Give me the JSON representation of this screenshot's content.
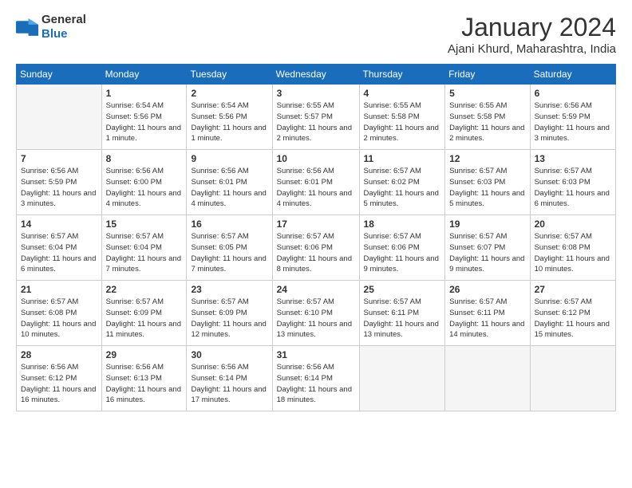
{
  "header": {
    "logo_general": "General",
    "logo_blue": "Blue",
    "month_title": "January 2024",
    "location": "Ajani Khurd, Maharashtra, India"
  },
  "weekdays": [
    "Sunday",
    "Monday",
    "Tuesday",
    "Wednesday",
    "Thursday",
    "Friday",
    "Saturday"
  ],
  "weeks": [
    [
      {
        "day": "",
        "empty": true
      },
      {
        "day": "1",
        "sunrise": "6:54 AM",
        "sunset": "5:56 PM",
        "daylight": "11 hours and 1 minute."
      },
      {
        "day": "2",
        "sunrise": "6:54 AM",
        "sunset": "5:56 PM",
        "daylight": "11 hours and 1 minute."
      },
      {
        "day": "3",
        "sunrise": "6:55 AM",
        "sunset": "5:57 PM",
        "daylight": "11 hours and 2 minutes."
      },
      {
        "day": "4",
        "sunrise": "6:55 AM",
        "sunset": "5:58 PM",
        "daylight": "11 hours and 2 minutes."
      },
      {
        "day": "5",
        "sunrise": "6:55 AM",
        "sunset": "5:58 PM",
        "daylight": "11 hours and 2 minutes."
      },
      {
        "day": "6",
        "sunrise": "6:56 AM",
        "sunset": "5:59 PM",
        "daylight": "11 hours and 3 minutes."
      }
    ],
    [
      {
        "day": "7",
        "sunrise": "6:56 AM",
        "sunset": "5:59 PM",
        "daylight": "11 hours and 3 minutes."
      },
      {
        "day": "8",
        "sunrise": "6:56 AM",
        "sunset": "6:00 PM",
        "daylight": "11 hours and 4 minutes."
      },
      {
        "day": "9",
        "sunrise": "6:56 AM",
        "sunset": "6:01 PM",
        "daylight": "11 hours and 4 minutes."
      },
      {
        "day": "10",
        "sunrise": "6:56 AM",
        "sunset": "6:01 PM",
        "daylight": "11 hours and 4 minutes."
      },
      {
        "day": "11",
        "sunrise": "6:57 AM",
        "sunset": "6:02 PM",
        "daylight": "11 hours and 5 minutes."
      },
      {
        "day": "12",
        "sunrise": "6:57 AM",
        "sunset": "6:03 PM",
        "daylight": "11 hours and 5 minutes."
      },
      {
        "day": "13",
        "sunrise": "6:57 AM",
        "sunset": "6:03 PM",
        "daylight": "11 hours and 6 minutes."
      }
    ],
    [
      {
        "day": "14",
        "sunrise": "6:57 AM",
        "sunset": "6:04 PM",
        "daylight": "11 hours and 6 minutes."
      },
      {
        "day": "15",
        "sunrise": "6:57 AM",
        "sunset": "6:04 PM",
        "daylight": "11 hours and 7 minutes."
      },
      {
        "day": "16",
        "sunrise": "6:57 AM",
        "sunset": "6:05 PM",
        "daylight": "11 hours and 7 minutes."
      },
      {
        "day": "17",
        "sunrise": "6:57 AM",
        "sunset": "6:06 PM",
        "daylight": "11 hours and 8 minutes."
      },
      {
        "day": "18",
        "sunrise": "6:57 AM",
        "sunset": "6:06 PM",
        "daylight": "11 hours and 9 minutes."
      },
      {
        "day": "19",
        "sunrise": "6:57 AM",
        "sunset": "6:07 PM",
        "daylight": "11 hours and 9 minutes."
      },
      {
        "day": "20",
        "sunrise": "6:57 AM",
        "sunset": "6:08 PM",
        "daylight": "11 hours and 10 minutes."
      }
    ],
    [
      {
        "day": "21",
        "sunrise": "6:57 AM",
        "sunset": "6:08 PM",
        "daylight": "11 hours and 10 minutes."
      },
      {
        "day": "22",
        "sunrise": "6:57 AM",
        "sunset": "6:09 PM",
        "daylight": "11 hours and 11 minutes."
      },
      {
        "day": "23",
        "sunrise": "6:57 AM",
        "sunset": "6:09 PM",
        "daylight": "11 hours and 12 minutes."
      },
      {
        "day": "24",
        "sunrise": "6:57 AM",
        "sunset": "6:10 PM",
        "daylight": "11 hours and 13 minutes."
      },
      {
        "day": "25",
        "sunrise": "6:57 AM",
        "sunset": "6:11 PM",
        "daylight": "11 hours and 13 minutes."
      },
      {
        "day": "26",
        "sunrise": "6:57 AM",
        "sunset": "6:11 PM",
        "daylight": "11 hours and 14 minutes."
      },
      {
        "day": "27",
        "sunrise": "6:57 AM",
        "sunset": "6:12 PM",
        "daylight": "11 hours and 15 minutes."
      }
    ],
    [
      {
        "day": "28",
        "sunrise": "6:56 AM",
        "sunset": "6:12 PM",
        "daylight": "11 hours and 16 minutes."
      },
      {
        "day": "29",
        "sunrise": "6:56 AM",
        "sunset": "6:13 PM",
        "daylight": "11 hours and 16 minutes."
      },
      {
        "day": "30",
        "sunrise": "6:56 AM",
        "sunset": "6:14 PM",
        "daylight": "11 hours and 17 minutes."
      },
      {
        "day": "31",
        "sunrise": "6:56 AM",
        "sunset": "6:14 PM",
        "daylight": "11 hours and 18 minutes."
      },
      {
        "day": "",
        "empty": true
      },
      {
        "day": "",
        "empty": true
      },
      {
        "day": "",
        "empty": true
      }
    ]
  ]
}
